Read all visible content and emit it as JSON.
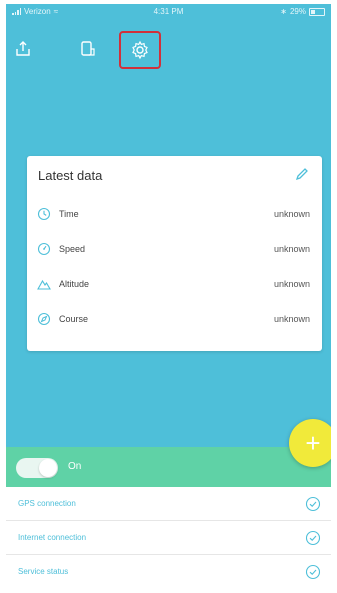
{
  "status_bar": {
    "carrier": "Verizon",
    "time": "4:31 PM",
    "battery": "29%"
  },
  "toolbar": {
    "icons": [
      "share-icon",
      "device-icon",
      "gear-icon"
    ]
  },
  "card": {
    "title": "Latest data",
    "rows": [
      {
        "label": "Time",
        "value": "unknown",
        "icon": "clock-icon"
      },
      {
        "label": "Speed",
        "value": "unknown",
        "icon": "speed-icon"
      },
      {
        "label": "Altitude",
        "value": "unknown",
        "icon": "mountain-icon"
      },
      {
        "label": "Course",
        "value": "unknown",
        "icon": "compass-icon"
      }
    ]
  },
  "fab": {
    "label": "+"
  },
  "toggle": {
    "label": "On",
    "checked": true
  },
  "status_list": {
    "items": [
      {
        "label": "GPS connection",
        "icon": "check-circle-icon"
      },
      {
        "label": "Internet connection",
        "icon": "check-circle-icon"
      },
      {
        "label": "Service status",
        "icon": "check-circle-icon"
      }
    ]
  },
  "colors": {
    "background": "#4ebfd9",
    "toggle_bar": "#5fd2a6",
    "fab": "#f1ea3a",
    "highlight": "#d1303a",
    "accent": "#4ebfd9"
  }
}
